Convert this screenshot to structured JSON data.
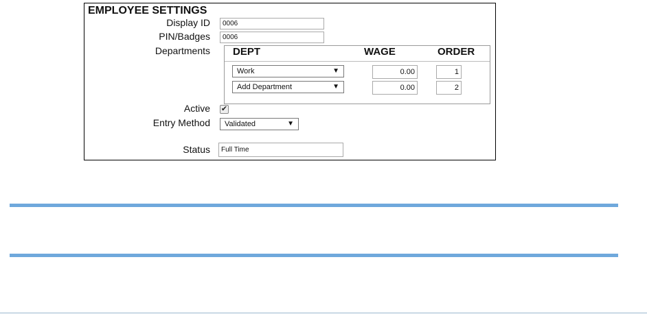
{
  "settings": {
    "title": "EMPLOYEE SETTINGS",
    "display_id": {
      "label": "Display ID",
      "value": "0006"
    },
    "pin_badges": {
      "label": "PIN/Badges",
      "value": "0006"
    },
    "departments": {
      "label": "Departments",
      "columns": {
        "dept": "DEPT",
        "wage": "WAGE",
        "order": "ORDER"
      },
      "rows": [
        {
          "dept": "Work",
          "wage": "0.00",
          "order": "1"
        },
        {
          "dept": "Add Department",
          "wage": "0.00",
          "order": "2"
        }
      ]
    },
    "active": {
      "label": "Active",
      "checked": true,
      "check_glyph": "✔"
    },
    "entry_method": {
      "label": "Entry Method",
      "value": "Validated"
    },
    "status": {
      "label": "Status",
      "value": "Full Time"
    },
    "dropdown_arrow": "▼"
  },
  "colors": {
    "rule_blue": "#6fa8dc",
    "border_dark": "#000000"
  }
}
